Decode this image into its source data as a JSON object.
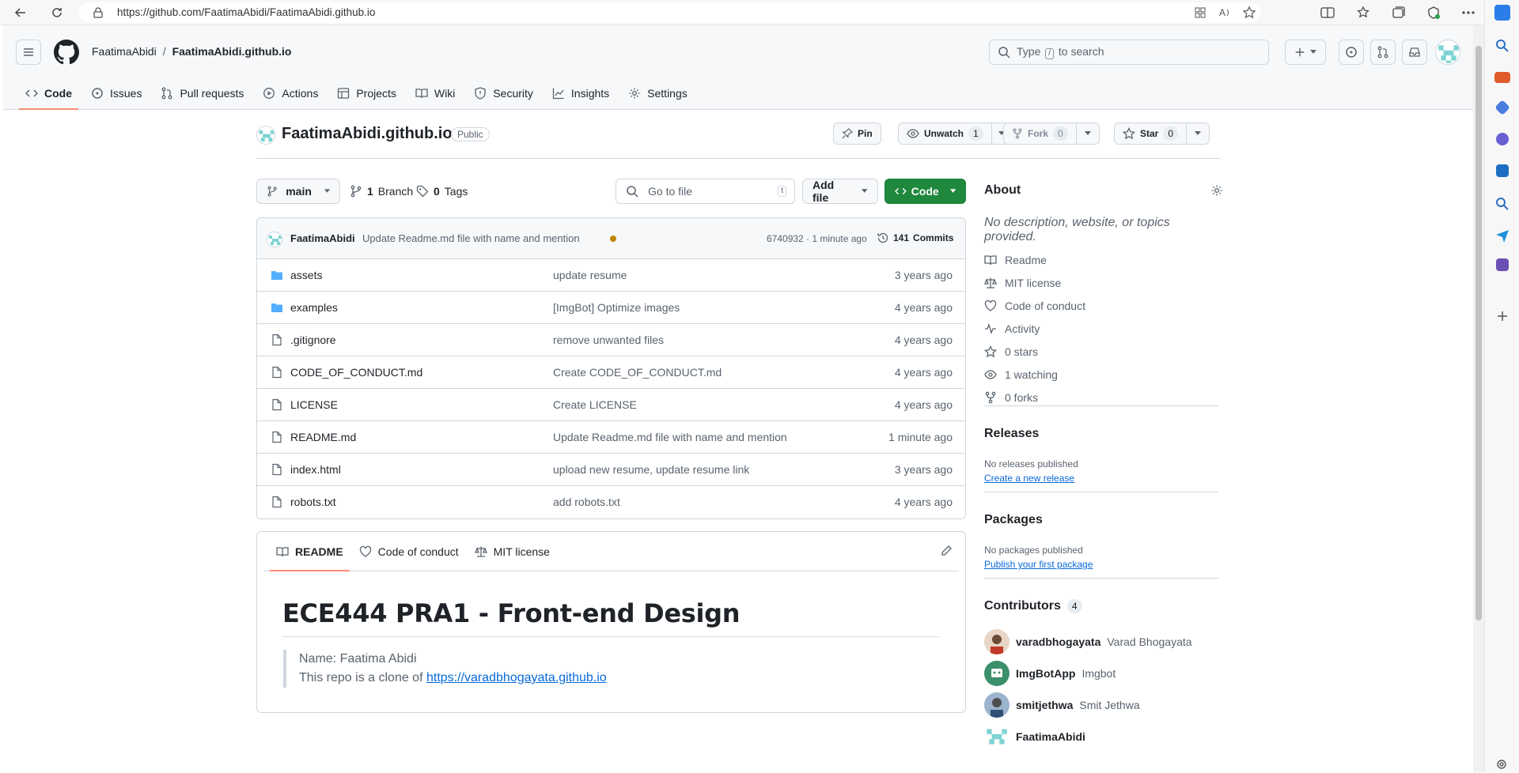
{
  "browser": {
    "url": "https://github.com/FaatimaAbidi/FaatimaAbidi.github.io"
  },
  "header": {
    "owner": "FaatimaAbidi",
    "separator": "/",
    "repo": "FaatimaAbidi.github.io",
    "search_prefix": "Type",
    "search_key": "/",
    "search_suffix": "to search"
  },
  "nav": {
    "tabs": [
      {
        "label": "Code",
        "icon": "code-icon"
      },
      {
        "label": "Issues",
        "icon": "issue-icon"
      },
      {
        "label": "Pull requests",
        "icon": "pull-request-icon"
      },
      {
        "label": "Actions",
        "icon": "play-icon"
      },
      {
        "label": "Projects",
        "icon": "table-icon"
      },
      {
        "label": "Wiki",
        "icon": "book-icon"
      },
      {
        "label": "Security",
        "icon": "shield-icon"
      },
      {
        "label": "Insights",
        "icon": "graph-icon"
      },
      {
        "label": "Settings",
        "icon": "gear-icon"
      }
    ]
  },
  "repo": {
    "name": "FaatimaAbidi.github.io",
    "visibility": "Public",
    "pin_label": "Pin",
    "unwatch_label": "Unwatch",
    "watch_count": "1",
    "fork_label": "Fork",
    "fork_count": "0",
    "star_label": "Star",
    "star_count": "0"
  },
  "controls": {
    "branch": "main",
    "branches_count": "1",
    "branches_label": "Branch",
    "tags_count": "0",
    "tags_label": "Tags",
    "goto_placeholder": "Go to file",
    "goto_key": "t",
    "add_file": "Add file",
    "code_button": "Code"
  },
  "commit": {
    "author": "FaatimaAbidi",
    "message": "Update Readme.md file with name and mention",
    "hash": "6740932",
    "sep": " · ",
    "time": "1 minute ago",
    "commits_count": "141",
    "commits_label": "Commits"
  },
  "files": [
    {
      "name": "assets",
      "type": "folder",
      "message": "update resume",
      "age": "3 years ago"
    },
    {
      "name": "examples",
      "type": "folder",
      "message": "[ImgBot] Optimize images",
      "age": "4 years ago"
    },
    {
      "name": ".gitignore",
      "type": "file",
      "message": "remove unwanted files",
      "age": "4 years ago"
    },
    {
      "name": "CODE_OF_CONDUCT.md",
      "type": "file",
      "message": "Create CODE_OF_CONDUCT.md",
      "age": "4 years ago"
    },
    {
      "name": "LICENSE",
      "type": "file",
      "message": "Create LICENSE",
      "age": "4 years ago"
    },
    {
      "name": "README.md",
      "type": "file",
      "message": "Update Readme.md file with name and mention",
      "age": "1 minute ago"
    },
    {
      "name": "index.html",
      "type": "file",
      "message": "upload new resume, update resume link",
      "age": "3 years ago"
    },
    {
      "name": "robots.txt",
      "type": "file",
      "message": "add robots.txt",
      "age": "4 years ago"
    }
  ],
  "readme": {
    "tabs": [
      "README",
      "Code of conduct",
      "MIT license"
    ],
    "heading": "ECE444 PRA1 - Front-end Design",
    "line1": "Name: Faatima Abidi",
    "line2_prefix": "This repo is a clone of",
    "line2_link": "https://varadbhogayata.github.io"
  },
  "about": {
    "title": "About",
    "description": "No description, website, or topics provided.",
    "items": [
      {
        "label": "Readme",
        "icon": "book-icon"
      },
      {
        "label": "MIT license",
        "icon": "law-icon"
      },
      {
        "label": "Code of conduct",
        "icon": "heart-icon"
      },
      {
        "label": "Activity",
        "icon": "pulse-icon"
      },
      {
        "label": "0 stars",
        "icon": "star-icon"
      },
      {
        "label": "1 watching",
        "icon": "eye-icon"
      },
      {
        "label": "0 forks",
        "icon": "fork-icon"
      }
    ]
  },
  "releases": {
    "title": "Releases",
    "empty": "No releases published",
    "link": "Create a new release"
  },
  "packages": {
    "title": "Packages",
    "empty": "No packages published",
    "link": "Publish your first package"
  },
  "contributors": {
    "title": "Contributors",
    "count": "4",
    "list": [
      {
        "login": "varadbhogayata",
        "name": "Varad Bhogayata"
      },
      {
        "login": "ImgBotApp",
        "name": "Imgbot"
      },
      {
        "login": "smitjethwa",
        "name": "Smit Jethwa"
      },
      {
        "login": "FaatimaAbidi",
        "name": ""
      }
    ]
  },
  "colors": {
    "accent_green": "#1f883d",
    "link_blue": "#0969da",
    "tab_underline": "#fd8c73",
    "folder_blue": "#54aeff"
  }
}
